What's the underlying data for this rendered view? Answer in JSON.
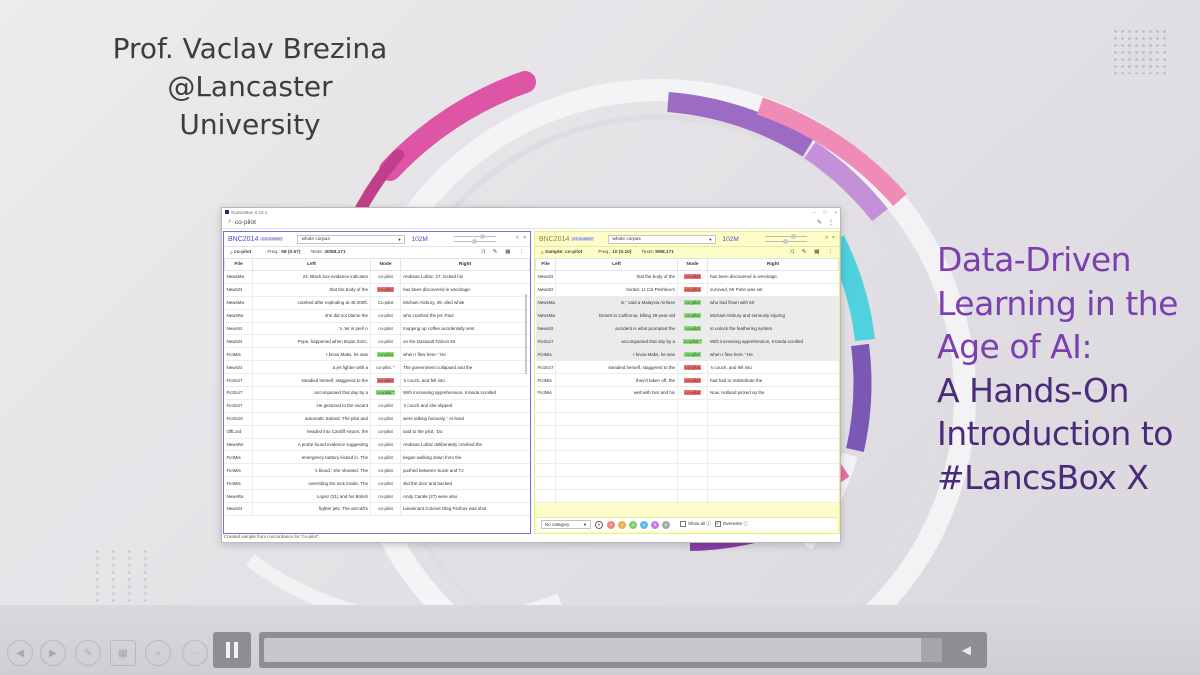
{
  "slide": {
    "author_line1": "Prof. Vaclav Brezina",
    "author_line2": "@Lancaster University",
    "headline": [
      "Data-Driven",
      "Learning in the",
      "Age of AI:",
      "A Hands-On",
      "Introduction to",
      "#LancsBox X"
    ]
  },
  "app": {
    "title": "#LancsBox X v3.1",
    "query": "co-pilot",
    "status": "Created sample from concordance for \"co-pilot\".",
    "left_panel": {
      "corpus": "BNC2014",
      "corpus_tag": "2.0 CLAWS7",
      "scope": "whole corpus",
      "tokens": "102M",
      "search_label": "co-pilot",
      "freq_label": "Freq.:",
      "freq_value": "58 (0.57)",
      "texts_label": "Texts:",
      "texts_value": "40/88,171",
      "columns": [
        "File",
        "Left",
        "Node",
        "Right"
      ],
      "rows": [
        {
          "file": "NewsMa",
          "left": "24. Black box evidence indicates",
          "node": "co-pilot",
          "right": "Andreas Lubitz, 27, locked his",
          "hl": ""
        },
        {
          "file": "NewsSt",
          "left": "that the body of the",
          "node": "co-pilot",
          "right": "has been discovered in wreckage.",
          "hl": "red"
        },
        {
          "file": "NewsMa",
          "left": "crashed after exploding at 45,000ft.",
          "node": "Co-pilot",
          "right": "Michael Alsbury, 39, died while",
          "hl": ""
        },
        {
          "file": "NewsRe",
          "left": "she did not blame the",
          "node": "co-pilot",
          "right": "who crashed the jet. Paul",
          "hl": ""
        },
        {
          "file": "NewsSt",
          "left": "'s Jet in peril A",
          "node": "co-pilot",
          "right": "mopping up coffee accidentally sent",
          "hl": ""
        },
        {
          "file": "NewsSt",
          "left": "Pope, happened when Bojan Zoric,",
          "node": "co-pilot",
          "right": "on the Dassault Falcon 50",
          "hl": ""
        },
        {
          "file": "FictMis",
          "left": "I know Maks, he was",
          "node": "co-pilot",
          "right": "when I flew here.' 'He",
          "hl": "green"
        },
        {
          "file": "NewsSt",
          "left": "a jet fighter with a",
          "node": "co-pilot. \"",
          "right": "The government collapsed and the",
          "hl": ""
        },
        {
          "file": "FictSci7",
          "left": "steadied herself, staggered to the",
          "node": "co-pilot",
          "right": "'s couch, and fell into",
          "hl": "red"
        },
        {
          "file": "FictSci7",
          "left": "accompanied that day by a",
          "node": "co-pilot.\"",
          "right": "With increasing apprehension, Kranda scrolled",
          "hl": "green"
        },
        {
          "file": "FictSci7",
          "left": "He gestured to the vacant",
          "node": "co-pilot",
          "right": "'s couch and she slipped",
          "hl": ""
        },
        {
          "file": "FictSciS",
          "left": "automatic trained. The pilot and",
          "node": "co-pilot",
          "right": "were talking furiously. ' At least",
          "hl": ""
        },
        {
          "file": "OffLord",
          "left": "headed into Cardiff Airport, the",
          "node": "co-pilot",
          "right": "said to the pilot, 'Do",
          "hl": ""
        },
        {
          "file": "NewsRe",
          "left": "A probe found evidence suggesting",
          "node": "co-pilot",
          "right": "Andreas Lubitz deliberately crashed the",
          "hl": ""
        },
        {
          "file": "FictMis",
          "left": "emergency battery kicked in. The",
          "node": "co-pilot",
          "right": "began walking down from the",
          "hl": ""
        },
        {
          "file": "FictMis",
          "left": "'s blood,' she shouted. The",
          "node": "co-pilot",
          "right": "pushed between Suzie and TJ",
          "hl": ""
        },
        {
          "file": "FictMis",
          "left": "overriding the lock inside. The",
          "node": "co-pilot",
          "right": "slid the door and backed",
          "hl": ""
        },
        {
          "file": "NewsRe",
          "left": "Lopez (31) and his British",
          "node": "co-pilot",
          "right": "Andy Cantle (27) were also",
          "hl": ""
        },
        {
          "file": "NewsSt",
          "left": "fighter jets. The aircraft's",
          "node": "co-pilot",
          "right": "Lieutenant Colonel Oleg Peshov was shot",
          "hl": ""
        }
      ]
    },
    "right_panel": {
      "corpus": "BNC2014",
      "corpus_tag": "2.0 CLAWS7",
      "scope": "whole corpus",
      "tokens": "102M",
      "search_label": "Sample: co-pilot",
      "freq_label": "Freq.:",
      "freq_value": "10 (0.10)",
      "texts_label": "Texts:",
      "texts_value": "9/88,171",
      "columns": [
        "File",
        "Left",
        "Node",
        "Right"
      ],
      "rows": [
        {
          "file": "NewsSt",
          "left": "that the body of the",
          "node": "co-pilot",
          "right": "has been discovered in wreckage.",
          "hl": "red",
          "grey": false
        },
        {
          "file": "NewsSt",
          "left": "border. Lt Col Peshkov's",
          "node": "co-pilot",
          "right": "survived, Mr Putin was set",
          "hl": "red",
          "grey": false
        },
        {
          "file": "NewsMa",
          "left": "is,\" said a Malaysia Airlines",
          "node": "co-pilot",
          "right": "who had flown with Mr",
          "hl": "green",
          "grey": true
        },
        {
          "file": "NewsMa",
          "left": "Desert in California, killing 39-year-old",
          "node": "co-pilot",
          "right": "Michael Alsbury and seriously injuring",
          "hl": "green",
          "grey": true
        },
        {
          "file": "NewsSt",
          "left": "accident is what prompted the",
          "node": "co-pilot",
          "right": "to unlock the feathering system",
          "hl": "green",
          "grey": true
        },
        {
          "file": "FictSci7",
          "left": "accompanied that day by a",
          "node": "co-pilot.\"",
          "right": "With increasing apprehension, Kranda scrolled",
          "hl": "green",
          "grey": true
        },
        {
          "file": "FictMis",
          "left": "I know Maks, he was",
          "node": "co-pilot",
          "right": "when I flew here.' 'He",
          "hl": "green",
          "grey": true
        },
        {
          "file": "FictSci7",
          "left": "steadied herself, staggered to the",
          "node": "co-pilot",
          "right": "'s couch, and fell into",
          "hl": "red",
          "grey": false
        },
        {
          "file": "FictMis",
          "left": "they'd taken off, the",
          "node": "co-pilot",
          "right": "had had to redistribute the",
          "hl": "red",
          "grey": false
        },
        {
          "file": "FictMis",
          "left": "well with him and his",
          "node": "co-pilot",
          "right": "Now, Holland picked up the",
          "hl": "red",
          "grey": false
        }
      ],
      "category": "No category",
      "category_colors": [
        {
          "n": "1",
          "color": "#ef8a7a"
        },
        {
          "n": "2",
          "color": "#f4a94e"
        },
        {
          "n": "3",
          "color": "#7ccf72"
        },
        {
          "n": "4",
          "color": "#62b6ea"
        },
        {
          "n": "5",
          "color": "#c07ee6"
        },
        {
          "n": "6",
          "color": "#a8a8a8"
        }
      ],
      "show_all": "Show all",
      "overwrite": "Overwrite"
    }
  },
  "colors": {
    "author_text": "#3d3d3d",
    "headline_light": "#7b3fb0",
    "headline_dark": "#4a2a7a",
    "left_panel_border": "#6f72d6",
    "right_panel_bg": "#fdfdc8",
    "highlight_red": "#ef7676",
    "highlight_green": "#8fe07c"
  },
  "player": {
    "icons": [
      "prev-icon",
      "next-icon",
      "pen-icon",
      "grid-icon",
      "zoom-icon",
      "more-icon",
      "pause-icon",
      "volume-icon"
    ]
  }
}
